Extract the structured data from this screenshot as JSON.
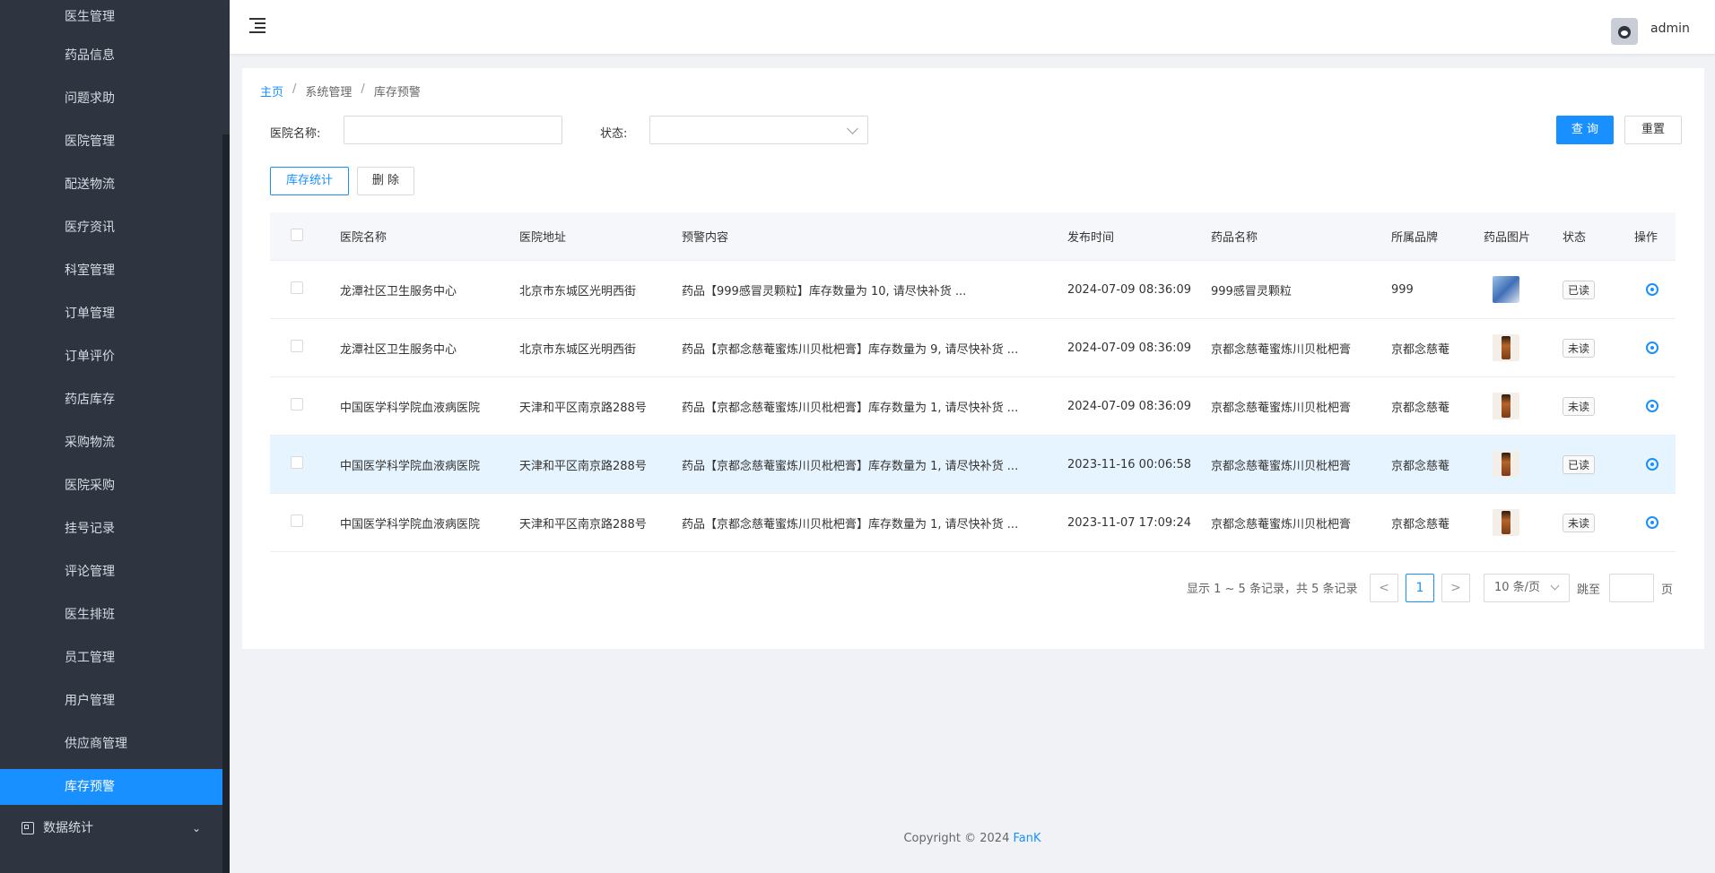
{
  "sidebar": {
    "items": [
      {
        "label": "医生管理"
      },
      {
        "label": "药品信息"
      },
      {
        "label": "问题求助"
      },
      {
        "label": "医院管理"
      },
      {
        "label": "配送物流"
      },
      {
        "label": "医疗资讯"
      },
      {
        "label": "科室管理"
      },
      {
        "label": "订单管理"
      },
      {
        "label": "订单评价"
      },
      {
        "label": "药店库存"
      },
      {
        "label": "采购物流"
      },
      {
        "label": "医院采购"
      },
      {
        "label": "挂号记录"
      },
      {
        "label": "评论管理"
      },
      {
        "label": "医生排班"
      },
      {
        "label": "员工管理"
      },
      {
        "label": "用户管理"
      },
      {
        "label": "供应商管理"
      },
      {
        "label": "库存预警",
        "active": true
      }
    ],
    "group": {
      "label": "数据统计",
      "icon": "chart-icon"
    },
    "accent": "#1890ff",
    "background": "#2e3440"
  },
  "header": {
    "username": "admin",
    "fold_icon": "menu-fold-icon"
  },
  "breadcrumb": {
    "items": [
      "主页",
      "系统管理",
      "库存预警"
    ],
    "separator": "/"
  },
  "search": {
    "hospital_label": "医院名称:",
    "hospital_value": "",
    "status_label": "状态:",
    "status_value": "",
    "query_button": "查 询",
    "reset_button": "重置"
  },
  "actions": {
    "stats_button": "库存统计",
    "delete_button": "删 除"
  },
  "table": {
    "columns": [
      "医院名称",
      "医院地址",
      "预警内容",
      "发布时间",
      "药品名称",
      "所属品牌",
      "药品图片",
      "状态",
      "操作"
    ],
    "rows": [
      {
        "hospital": "龙潭社区卫生服务中心",
        "address": "北京市东城区光明西街",
        "content": "药品【999感冒灵颗粒】库存数量为 10, 请尽快补货 ...",
        "time": "2024-07-09 08:36:09",
        "drug": "999感冒灵颗粒",
        "brand": "999",
        "image": "medicine-box-image",
        "status": "已读"
      },
      {
        "hospital": "龙潭社区卫生服务中心",
        "address": "北京市东城区光明西街",
        "content": "药品【京都念慈菴蜜炼川贝枇杷膏】库存数量为 9, 请尽快补货 ...",
        "time": "2024-07-09 08:36:09",
        "drug": "京都念慈菴蜜炼川贝枇杷膏",
        "brand": "京都念慈菴",
        "image": "syrup-bottle-image",
        "status": "未读"
      },
      {
        "hospital": "中国医学科学院血液病医院",
        "address": "天津和平区南京路288号",
        "content": "药品【京都念慈菴蜜炼川贝枇杷膏】库存数量为 1, 请尽快补货 ...",
        "time": "2024-07-09 08:36:09",
        "drug": "京都念慈菴蜜炼川贝枇杷膏",
        "brand": "京都念慈菴",
        "image": "syrup-bottle-image",
        "status": "未读"
      },
      {
        "hospital": "中国医学科学院血液病医院",
        "address": "天津和平区南京路288号",
        "content": "药品【京都念慈菴蜜炼川贝枇杷膏】库存数量为 1, 请尽快补货 ...",
        "time": "2023-11-16 00:06:58",
        "drug": "京都念慈菴蜜炼川贝枇杷膏",
        "brand": "京都念慈菴",
        "image": "syrup-bottle-image",
        "status": "已读"
      },
      {
        "hospital": "中国医学科学院血液病医院",
        "address": "天津和平区南京路288号",
        "content": "药品【京都念慈菴蜜炼川贝枇杷膏】库存数量为 1, 请尽快补货 ...",
        "time": "2023-11-07 17:09:24",
        "drug": "京都念慈菴蜜炼川贝枇杷膏",
        "brand": "京都念慈菴",
        "image": "syrup-bottle-image",
        "status": "未读"
      }
    ]
  },
  "pagination": {
    "summary": "显示 1 ~ 5 条记录，共 5 条记录",
    "current_page": "1",
    "page_size": "10 条/页",
    "jump_label": "跳至",
    "page_unit": "页",
    "prev": "<",
    "next": ">"
  },
  "footer": {
    "copyright": "Copyright © 2024",
    "brand": "FanK"
  }
}
